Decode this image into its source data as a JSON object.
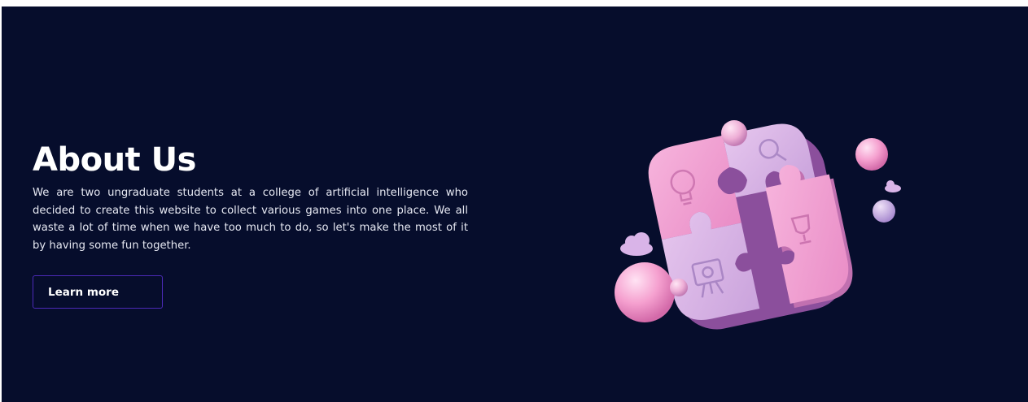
{
  "about": {
    "title": "About Us",
    "description": "We are two ungraduate students at a college of artificial intelligence who decided to create this website to collect various games into one place. We all waste a lot of time when we have too much to do, so let's make the most of it by having some fun together.",
    "button_label": "Learn more"
  },
  "illustration": {
    "icon": "puzzle-illustration-icon",
    "piece_icons": [
      "lightbulb-icon",
      "magnifier-icon",
      "presentation-board-icon",
      "trophy-icon"
    ]
  },
  "colors": {
    "background": "#060d2c",
    "text": "#ffffff",
    "button_border": "#4b2ab7",
    "puzzle_pink": "#f1a6d7",
    "puzzle_lilac": "#d7b3e6"
  }
}
